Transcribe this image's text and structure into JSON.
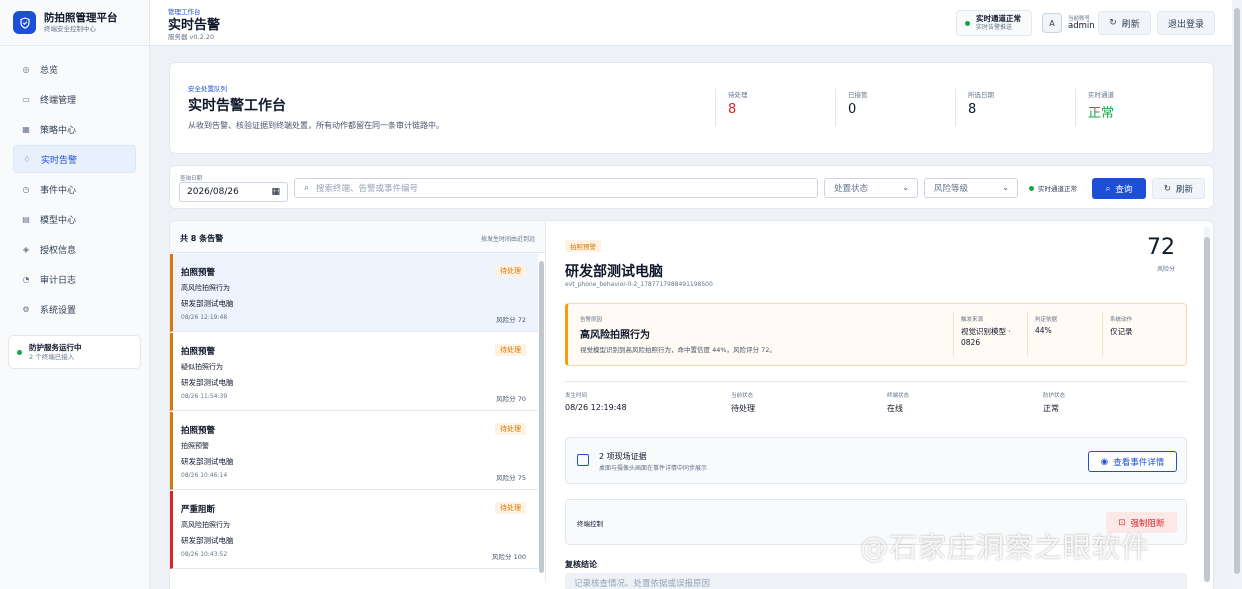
{
  "brand": {
    "title": "防拍照管理平台",
    "subtitle": "终端安全控制中心"
  },
  "nav": [
    {
      "label": "总览",
      "icon": "dashboard-icon"
    },
    {
      "label": "终端管理",
      "icon": "monitor-icon"
    },
    {
      "label": "策略中心",
      "icon": "policy-icon"
    },
    {
      "label": "实时告警",
      "icon": "bell-icon",
      "active": true
    },
    {
      "label": "事件中心",
      "icon": "event-icon"
    },
    {
      "label": "模型中心",
      "icon": "model-icon"
    },
    {
      "label": "授权信息",
      "icon": "license-icon"
    },
    {
      "label": "审计日志",
      "icon": "audit-icon"
    },
    {
      "label": "系统设置",
      "icon": "settings-icon"
    }
  ],
  "service": {
    "title": "防护服务运行中",
    "sub": "2 个终端已接入"
  },
  "header": {
    "crumb": "管理工作台",
    "title": "实时告警",
    "version": "服务器 v0.2.20",
    "channel_title": "实时通道正常",
    "channel_sub": "实时告警推送",
    "avatar": "A",
    "user_label": "当前账号",
    "user_name": "admin",
    "refresh": "刷新",
    "logout": "退出登录"
  },
  "hero": {
    "kicker": "安全处置队列",
    "title": "实时告警工作台",
    "desc": "从收到告警、核验证据到终端处置，所有动作都留在同一条审计链路中。",
    "stats": [
      {
        "label": "待处理",
        "value": "8",
        "color": "#dc2626"
      },
      {
        "label": "已接管",
        "value": "0",
        "color": "#0f172a"
      },
      {
        "label": "所选日期",
        "value": "8",
        "color": "#0f172a"
      },
      {
        "label": "实时通道",
        "value": "正常",
        "color": "#16a34a"
      }
    ]
  },
  "filter": {
    "date_label": "查询日期",
    "date_value": "2026/08/26",
    "search_placeholder": "搜索终端、告警或事件编号",
    "status_placeholder": "处置状态",
    "risk_placeholder": "风险等级",
    "channel": "实时通道正常",
    "query": "查询",
    "refresh": "刷新"
  },
  "list": {
    "title": "共 8 条告警",
    "sort": "按发生时间由近到远",
    "items": [
      {
        "title": "拍照预警",
        "line1": "高风险拍照行为",
        "line2": "研发部测试电脑",
        "time": "08/26 12:19:48",
        "score": "风险分 72",
        "status": "待处理"
      },
      {
        "title": "拍照预警",
        "line1": "疑似拍照行为",
        "line2": "研发部测试电脑",
        "time": "08/26 11:54:39",
        "score": "风险分 70",
        "status": "待处理"
      },
      {
        "title": "拍照预警",
        "line1": "拍照预警",
        "line2": "研发部测试电脑",
        "time": "08/26 10:46:14",
        "score": "风险分 75",
        "status": "待处理"
      },
      {
        "title": "严重阻断",
        "line1": "高风险拍照行为",
        "line2": "研发部测试电脑",
        "time": "08/26 10:43:52",
        "score": "风险分 100",
        "status": "待处理"
      }
    ]
  },
  "detail": {
    "tag": "拍照预警",
    "title": "研发部测试电脑",
    "event_id": "evt_phone_behavior-0-2_1787717988491198500",
    "score": "72",
    "score_label": "风险分",
    "reason_label": "告警原因",
    "reason_title": "高风险拍照行为",
    "reason_desc": "视觉模型识别到高风险拍照行为，命中置信度 44%，风险评分 72。",
    "source_label": "触发来源",
    "source_value": "视觉识别模型 · 0826",
    "confidence_label": "判定依据",
    "confidence_value": "44%",
    "action_label": "系统动作",
    "action_value": "仅记录",
    "meta": [
      {
        "label": "发生时间",
        "value": "08/26 12:19:48"
      },
      {
        "label": "当前状态",
        "value": "待处理"
      },
      {
        "label": "终端状态",
        "value": "在线"
      },
      {
        "label": "防护状态",
        "value": "正常"
      }
    ],
    "evidence_title": "2 项现场证据",
    "evidence_sub": "桌面与摄像头画面在事件详情中同步展示",
    "evidence_button": "查看事件详情",
    "control_label": "终端控制",
    "control_button": "强制阻断",
    "review_label": "复核结论",
    "review_placeholder": "记录核查情况、处置依据或误报原因"
  },
  "watermark": "@石家庄洞察之眼软件"
}
